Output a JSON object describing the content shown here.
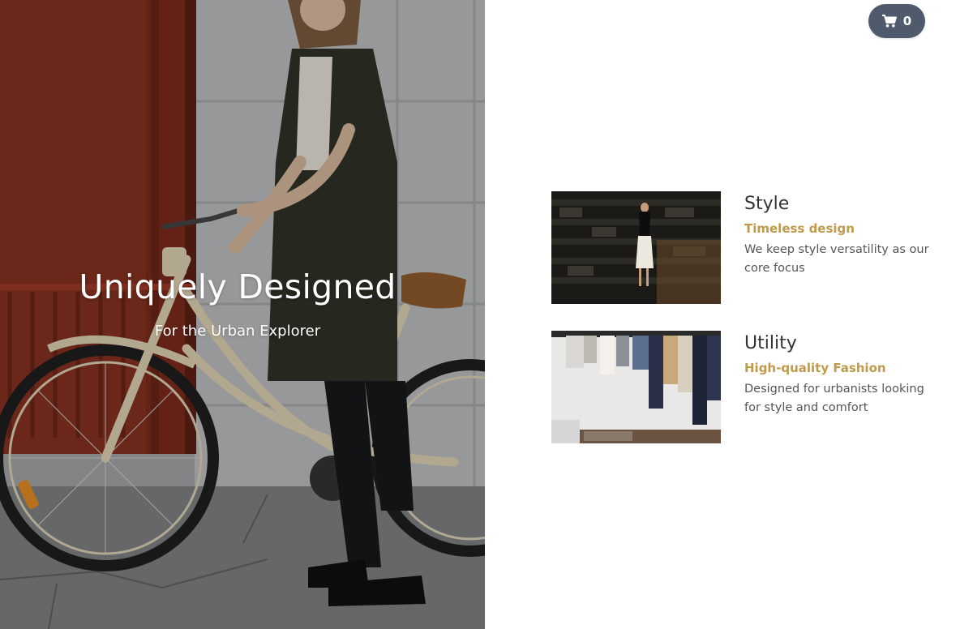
{
  "hero": {
    "title": "Uniquely Designed",
    "subtitle": "For the Urban Explorer"
  },
  "cart": {
    "icon": "shopping-cart-icon",
    "count": "0",
    "background": "#4f5b6c"
  },
  "features": [
    {
      "title": "Style",
      "subtitle": "Timeless design",
      "description": "We keep style versatility as our core focus"
    },
    {
      "title": "Utility",
      "subtitle": "High-quality Fashion",
      "description": "Designed for urbanists looking for style and comfort"
    }
  ],
  "colors": {
    "accent": "#bf9a4a",
    "heading": "#333333",
    "body_text": "#555555"
  }
}
